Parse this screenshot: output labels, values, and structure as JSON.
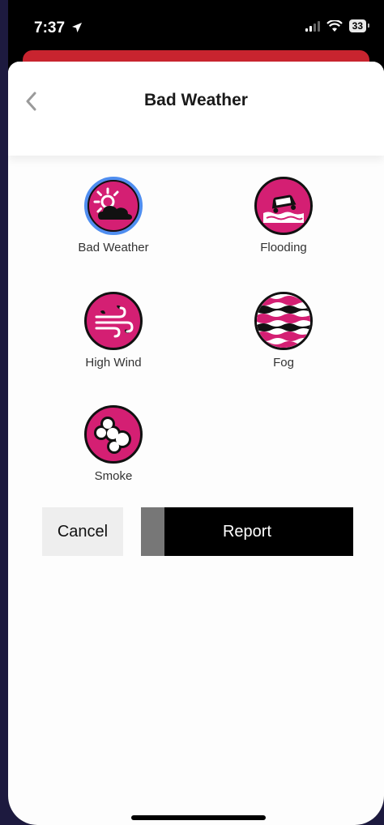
{
  "status_bar": {
    "time": "7:37",
    "battery": "33"
  },
  "header": {
    "title": "Bad Weather",
    "back_icon": "chevron-left-icon"
  },
  "colors": {
    "icon_bg": "#d41f73",
    "selected_ring": "#4f8ef0",
    "alert_strip": "#c8242f"
  },
  "options": [
    {
      "label": "Bad Weather",
      "icon": "sun-cloud-icon",
      "selected": true
    },
    {
      "label": "Flooding",
      "icon": "flooded-car-icon",
      "selected": false
    },
    {
      "label": "High Wind",
      "icon": "wind-icon",
      "selected": false
    },
    {
      "label": "Fog",
      "icon": "fog-waves-icon",
      "selected": false
    },
    {
      "label": "Smoke",
      "icon": "smoke-icon",
      "selected": false
    }
  ],
  "actions": {
    "cancel_label": "Cancel",
    "report_label": "Report",
    "report_progress": 0.11
  }
}
